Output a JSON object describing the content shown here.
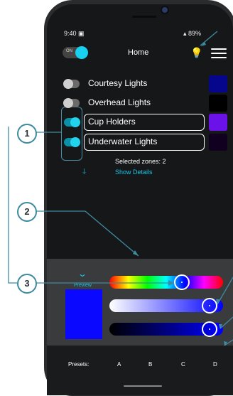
{
  "status_bar": {
    "time": "9:40",
    "right": "89%"
  },
  "header": {
    "master_toggle": "ON",
    "title": "Home"
  },
  "zones": [
    {
      "label": "Courtesy Lights",
      "on": false,
      "selected": false,
      "color": "#05068c"
    },
    {
      "label": "Overhead Lights",
      "on": false,
      "selected": false,
      "color": "#000000"
    },
    {
      "label": "Cup Holders",
      "on": true,
      "selected": true,
      "color": "#6b12e8"
    },
    {
      "label": "Underwater Lights",
      "on": true,
      "selected": true,
      "color": "#11001f"
    }
  ],
  "selected_zones": "Selected zones: 2",
  "show_details": "Show Details",
  "picker": {
    "preview_label": "Preview",
    "preview_color": "#0a08ff",
    "hue_position": 0.65,
    "saturation_position": 0.93,
    "value_position": 0.93
  },
  "presets": {
    "label": "Presets:",
    "items": [
      "A",
      "B",
      "C",
      "D"
    ]
  },
  "callouts": [
    "1",
    "2",
    "3"
  ],
  "colors": {
    "accent": "#18d0f0",
    "callout": "#3e8aa0"
  }
}
